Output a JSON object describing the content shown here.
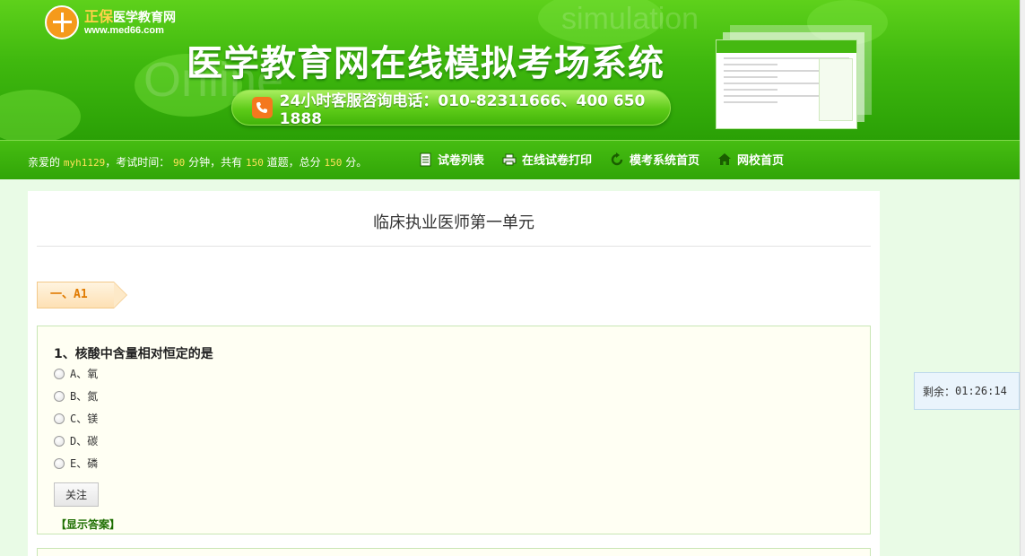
{
  "header": {
    "logo_brand": "正保",
    "logo_name": "医学教育网",
    "logo_url": "www.med66.com",
    "title": "医学教育网在线模拟考场系统",
    "hotline": "24小时客服咨询电话：010-82311666、400 650 1888",
    "bg_word_1": "simulation",
    "bg_word_2": "Online"
  },
  "nav": {
    "greeting_prefix": "亲爱的",
    "username": "myh1129",
    "exam_time_label": "，考试时间：",
    "exam_minutes": "90",
    "minutes_unit": "分钟，共有",
    "question_count": "150",
    "questions_unit": "道题，总分",
    "total_score": "150",
    "score_unit": "分。",
    "links": [
      {
        "label": "试卷列表",
        "icon": "document-icon"
      },
      {
        "label": "在线试卷打印",
        "icon": "printer-icon"
      },
      {
        "label": "模考系统首页",
        "icon": "refresh-icon"
      },
      {
        "label": "网校首页",
        "icon": "home-icon"
      }
    ]
  },
  "paper": {
    "title": "临床执业医师第一单元",
    "section_label": "一、A1",
    "question": {
      "text": "1、核酸中含量相对恒定的是",
      "options": [
        "A、氧",
        "B、氮",
        "C、镁",
        "D、碳",
        "E、磷"
      ],
      "follow_label": "关注",
      "show_answer_label": "【显示答案】"
    }
  },
  "timer": {
    "label": "剩余：",
    "value": "01:26:14"
  },
  "colors": {
    "header_green": "#3fb80e",
    "nav_green": "#31a507",
    "highlight_yellow": "#ffe35a",
    "tag_orange": "#e07a00"
  }
}
